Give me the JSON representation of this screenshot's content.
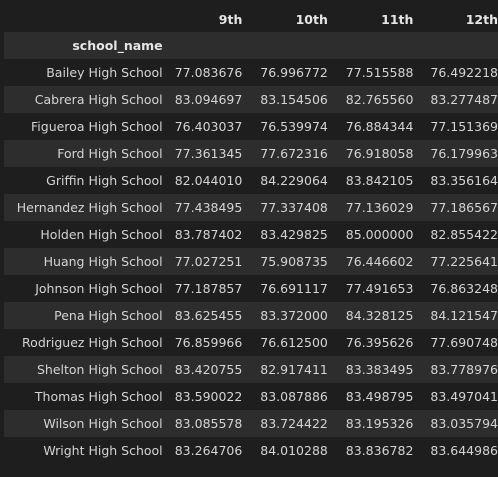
{
  "columns": [
    "9th",
    "10th",
    "11th",
    "12th"
  ],
  "index_name": "school_name",
  "rows": [
    {
      "school": "Bailey High School",
      "values": [
        "77.083676",
        "76.996772",
        "77.515588",
        "76.492218"
      ]
    },
    {
      "school": "Cabrera High School",
      "values": [
        "83.094697",
        "83.154506",
        "82.765560",
        "83.277487"
      ]
    },
    {
      "school": "Figueroa High School",
      "values": [
        "76.403037",
        "76.539974",
        "76.884344",
        "77.151369"
      ]
    },
    {
      "school": "Ford High School",
      "values": [
        "77.361345",
        "77.672316",
        "76.918058",
        "76.179963"
      ]
    },
    {
      "school": "Griffin High School",
      "values": [
        "82.044010",
        "84.229064",
        "83.842105",
        "83.356164"
      ]
    },
    {
      "school": "Hernandez High School",
      "values": [
        "77.438495",
        "77.337408",
        "77.136029",
        "77.186567"
      ]
    },
    {
      "school": "Holden High School",
      "values": [
        "83.787402",
        "83.429825",
        "85.000000",
        "82.855422"
      ]
    },
    {
      "school": "Huang High School",
      "values": [
        "77.027251",
        "75.908735",
        "76.446602",
        "77.225641"
      ]
    },
    {
      "school": "Johnson High School",
      "values": [
        "77.187857",
        "76.691117",
        "77.491653",
        "76.863248"
      ]
    },
    {
      "school": "Pena High School",
      "values": [
        "83.625455",
        "83.372000",
        "84.328125",
        "84.121547"
      ]
    },
    {
      "school": "Rodriguez High School",
      "values": [
        "76.859966",
        "76.612500",
        "76.395626",
        "77.690748"
      ]
    },
    {
      "school": "Shelton High School",
      "values": [
        "83.420755",
        "82.917411",
        "83.383495",
        "83.778976"
      ]
    },
    {
      "school": "Thomas High School",
      "values": [
        "83.590022",
        "83.087886",
        "83.498795",
        "83.497041"
      ]
    },
    {
      "school": "Wilson High School",
      "values": [
        "83.085578",
        "83.724422",
        "83.195326",
        "83.035794"
      ]
    },
    {
      "school": "Wright High School",
      "values": [
        "83.264706",
        "84.010288",
        "83.836782",
        "83.644986"
      ]
    }
  ]
}
